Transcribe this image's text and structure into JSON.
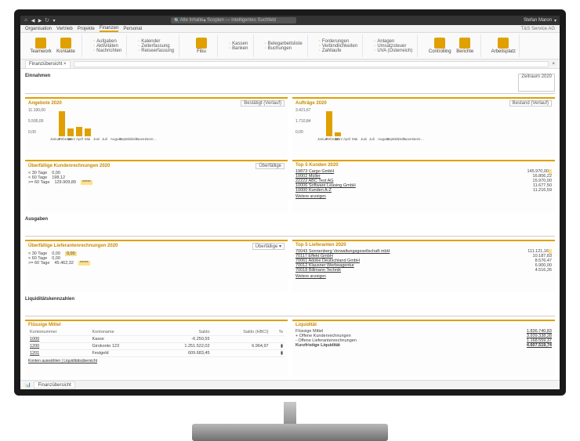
{
  "title": {
    "search_prefix": "Alle Inhalte",
    "search_hint": "Scopien — intelligentes Suchfeld",
    "user": "Stefan Maron",
    "company": "T&S Service AG"
  },
  "menu": {
    "items": [
      "Organisation",
      "Vertrieb",
      "Projekte",
      "Finanzen",
      "Personal"
    ],
    "active": "Finanzen"
  },
  "ribbon": {
    "g1_big": [
      "Teamwork",
      "Kontakte"
    ],
    "g2": [
      "Aufgaben",
      "Aktivitäten",
      "Nachrichten"
    ],
    "g3": [
      "Kalender",
      "Zeiterfassung",
      "Reiseerfassung"
    ],
    "g4_big": "Fibu",
    "g5": [
      "Kassen",
      "Banken",
      "Belegarbeitsliste",
      "Buchungen"
    ],
    "g6": [
      "Forderungen",
      "Verbindlichkeiten",
      "Zahllaufe"
    ],
    "g7": [
      "Anlagen",
      "Umsatzsteuer",
      "UVA (Österreich)"
    ],
    "g8_big": [
      "Controlling",
      "Berichte"
    ],
    "g9_big": "Arbeitsplatz"
  },
  "tab": {
    "name": "Finanzübersicht"
  },
  "header": {
    "einnahmen": "Einnahmen",
    "zeitraum_sel": "Zeitraum 2020"
  },
  "angebote": {
    "title": "Angebote 2020",
    "sel": "Bestätigt (Verlauf)",
    "ymax_label": "11.190,00",
    "ymid_label": "5.595,00",
    "yzero": "0,00"
  },
  "auftraege": {
    "title": "Aufträge 2020",
    "sel": "Bestand (Verlauf)",
    "ymax_label": "3.421,67",
    "ymid_label": "1.710,84",
    "yzero": "0,00"
  },
  "months": [
    "Januar",
    "Februar",
    "März",
    "April",
    "Mai",
    "Juni",
    "Juli",
    "August",
    "Septe…",
    "Oktob…",
    "Nove…",
    "Deze…"
  ],
  "ueberfKunden": {
    "title": "Überfällige Kundenrechnungen 2020",
    "btn": "Überfällige",
    "rows": [
      {
        "label": "< 30 Tage",
        "val": "0,00"
      },
      {
        "label": "< 60 Tage",
        "val": "198,12"
      },
      {
        "label": ">= 60 Tage",
        "val": "129.909,89",
        "hl": "*****"
      }
    ]
  },
  "top5kunden": {
    "title": "Top 5 Kunden 2020",
    "rows": [
      {
        "k": "19873 Cargo GmbH",
        "v": "145.970,00",
        "hl": "   "
      },
      {
        "k": "10002 Müller",
        "v": "16.806,22"
      },
      {
        "k": "22222 ABC Test AG",
        "v": "15.970,00"
      },
      {
        "k": "10006 Software Leasing GmbH",
        "v": "11.677,50"
      },
      {
        "k": "10000 Kunden A-Z",
        "v": "11.216,59"
      }
    ],
    "more": "Weitere anzeigen"
  },
  "ausgaben": {
    "title": "Ausgaben"
  },
  "ueberfLief": {
    "title": "Überfällige Lieferantenrechnungen 2020",
    "btn": "Überfällige ▾",
    "rows": [
      {
        "label": "< 30 Tage",
        "val": "0,00",
        "hl0": "0,00"
      },
      {
        "label": "< 60 Tage",
        "val": "0,00"
      },
      {
        "label": ">= 60 Tage",
        "val": "45.462,32",
        "hl": "*****"
      }
    ]
  },
  "top5lief": {
    "title": "Top 5 Lieferanten 2020",
    "rows": [
      {
        "k": "70043 Sonnenberg Verwaltungsgesellschaft mbH",
        "v": "111.121,16",
        "hl": " "
      },
      {
        "k": "70117 Effekt GmbH",
        "v": "10.187,83"
      },
      {
        "k": "70061 Adobe Deutschland GmbH",
        "v": "8.576,47"
      },
      {
        "k": "70012 Klausner Werbeagentur",
        "v": "6.900,00"
      },
      {
        "k": "70018 Billmann Technik",
        "v": "4.516,26"
      }
    ],
    "more": "Weitere anzeigen"
  },
  "liq_hdr": "Liquiditätskennzahlen",
  "fluessig": {
    "title": "Flüssige Mittel",
    "cols": [
      "Kontonummer",
      "Kontoname",
      "Saldo",
      "Saldo (HBCI)",
      "%"
    ],
    "rows": [
      {
        "nr": "1000",
        "name": "Kasse",
        "saldo": "-6.250,55",
        "hbci": "",
        "pct": ""
      },
      {
        "nr": "1200",
        "name": "Girokonto 123",
        "saldo": "1.251.522,02",
        "hbci": "6.964,97",
        "pct": "▮"
      },
      {
        "nr": "1201",
        "name": "Festgeld",
        "saldo": "609.683,45",
        "hbci": "",
        "pct": "▮"
      }
    ],
    "footer": "Konten auswählen | Liquiditätsübersicht"
  },
  "liquiditaet": {
    "title": "Liquidität",
    "rows": [
      {
        "k": "Flüssige Mittel",
        "v": "1.836.740,83"
      },
      {
        "k": "+ Offene Kundenrechnungen",
        "v": "3.939.338,28"
      },
      {
        "k": "- Offene Lieferantenrechnungen",
        "v": "1.168.559,37"
      },
      {
        "k": "Kurzfristige Liquidität",
        "v": "4.607.519,74",
        "bold": true
      }
    ]
  },
  "status": {
    "tab": "Finanzübersicht"
  },
  "chart_data": [
    {
      "type": "bar",
      "title": "Angebote 2020 — Bestätigt (Verlauf)",
      "categories": [
        "Januar",
        "Februar",
        "März",
        "April",
        "Mai",
        "Juni",
        "Juli",
        "August",
        "September",
        "Oktober",
        "November",
        "Dezember"
      ],
      "values": [
        0,
        11190,
        3500,
        4200,
        3800,
        0,
        0,
        0,
        0,
        0,
        0,
        0
      ],
      "ylim": [
        0,
        11190
      ],
      "ylabel": "",
      "xlabel": ""
    },
    {
      "type": "bar",
      "title": "Aufträge 2020 — Bestand (Verlauf)",
      "categories": [
        "Januar",
        "Februar",
        "März",
        "April",
        "Mai",
        "Juni",
        "Juli",
        "August",
        "September",
        "Oktober",
        "November",
        "Dezember"
      ],
      "values": [
        0,
        3421.67,
        600,
        0,
        0,
        0,
        0,
        0,
        0,
        0,
        0,
        0
      ],
      "ylim": [
        0,
        3421.67
      ],
      "ylabel": "",
      "xlabel": ""
    }
  ]
}
